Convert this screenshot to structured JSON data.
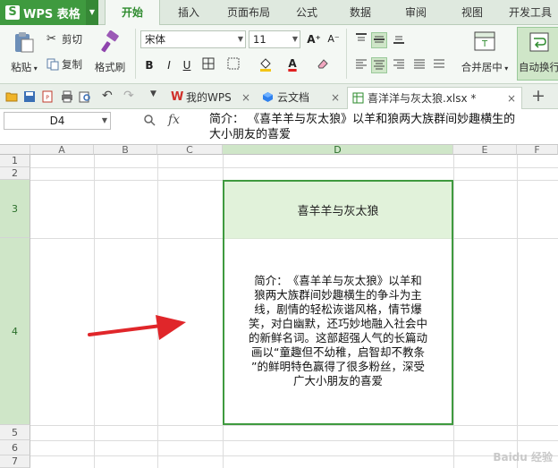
{
  "app": {
    "name": "WPS 表格",
    "logo_letter": "S"
  },
  "menu_tabs": [
    "开始",
    "插入",
    "页面布局",
    "公式",
    "数据",
    "审阅",
    "视图",
    "开发工具"
  ],
  "ribbon": {
    "paste": "粘贴",
    "cut": "剪切",
    "copy": "复制",
    "format_painter": "格式刷",
    "font_name": "宋体",
    "font_size": "11",
    "merge_center": "合并居中",
    "wrap_text": "自动换行",
    "bold": "B",
    "italic": "I",
    "underline": "U",
    "grow_font": "A⁺",
    "shrink_font": "A⁻"
  },
  "doc_tabs": [
    {
      "label": "我的WPS"
    },
    {
      "label": "云文档"
    },
    {
      "label": "喜洋洋与灰太狼.xlsx *"
    }
  ],
  "formula_bar": {
    "cell_ref": "D4",
    "fx": "fx",
    "content": "简介：  《喜羊羊与灰太狼》以羊和狼两大族群间妙趣横生的争斗为主线，剧情的轻松诙谐风格，情节爆笑，对白幽默，还巧妙地融入社会中的新鲜名词。这部超强人气的长篇动画以“童趣但不幼稚，启智却不教条”的鲜明特色赢得了很多粉丝，深受广大小朋友的喜爱",
    "content_visible": "简介：  《喜羊羊与灰太狼》以羊和狼两大族群间妙趣横生的\n大小朋友的喜爱"
  },
  "grid": {
    "columns": [
      "A",
      "B",
      "C",
      "D",
      "E",
      "F"
    ],
    "rows": [
      "1",
      "2",
      "3",
      "4",
      "5",
      "6",
      "7"
    ],
    "title_cell": "喜羊羊与灰太狼",
    "content_cell": "简介：  《喜羊羊与灰太狼》以羊和狼两大族群间妙趣横生的争斗为主线，剧情的轻松诙谐风格，情节爆笑，对白幽默，还巧妙地融入社会中的新鲜名词。这部超强人气的长篇动画以“童趣但不幼稚，启智却不教条”的鲜明特色赢得了很多粉丝，深受广大小朋友的喜爱",
    "selected_cell": "D4"
  },
  "colors": {
    "accent": "#3f9a3f",
    "title_fill": "#e1f2da",
    "arrow": "#e0262a"
  },
  "watermark": "Baidu 经验"
}
